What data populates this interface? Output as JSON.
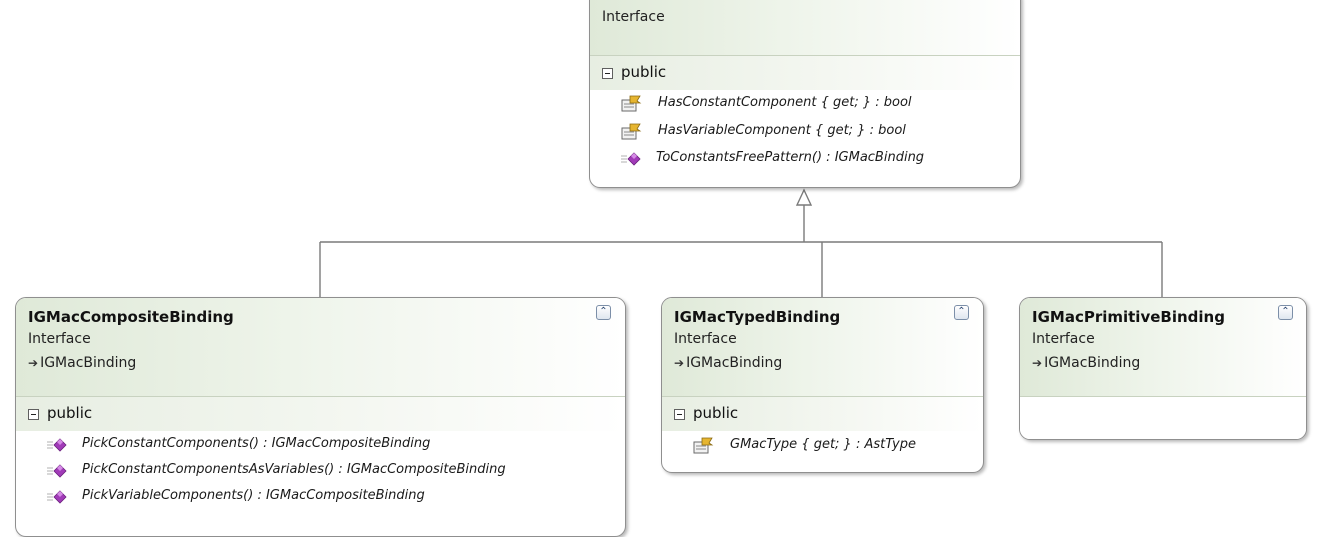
{
  "diagram": {
    "parent": {
      "stereotype": "Interface",
      "section_label": "public",
      "members": [
        {
          "kind": "property",
          "icon": "property-icon",
          "text": "HasConstantComponent { get; } : bool"
        },
        {
          "kind": "property",
          "icon": "property-icon",
          "text": "HasVariableComponent { get; } : bool"
        },
        {
          "kind": "method",
          "icon": "method-icon",
          "text": "ToConstantsFreePattern() : IGMacBinding"
        }
      ]
    },
    "children": [
      {
        "name": "IGMacCompositeBinding",
        "stereotype": "Interface",
        "inherits_arrow": "➔",
        "inherits": "IGMacBinding",
        "section_label": "public",
        "members": [
          {
            "kind": "method",
            "icon": "method-icon",
            "text": "PickConstantComponents() : IGMacCompositeBinding"
          },
          {
            "kind": "method",
            "icon": "method-icon",
            "text": "PickConstantComponentsAsVariables() : IGMacCompositeBinding"
          },
          {
            "kind": "method",
            "icon": "method-icon",
            "text": "PickVariableComponents() : IGMacCompositeBinding"
          }
        ]
      },
      {
        "name": "IGMacTypedBinding",
        "stereotype": "Interface",
        "inherits_arrow": "➔",
        "inherits": "IGMacBinding",
        "section_label": "public",
        "members": [
          {
            "kind": "property",
            "icon": "property-icon",
            "text": "GMacType { get; } : AstType"
          }
        ]
      },
      {
        "name": "IGMacPrimitiveBinding",
        "stereotype": "Interface",
        "inherits_arrow": "➔",
        "inherits": "IGMacBinding"
      }
    ],
    "collapse_glyph": "⌃",
    "colors": {
      "header_green": "#dfe9d8",
      "border": "#8f8f8f",
      "method_purple": "#a13bb8",
      "property_yellow": "#e6b530",
      "connector": "#7a7a7a"
    }
  }
}
